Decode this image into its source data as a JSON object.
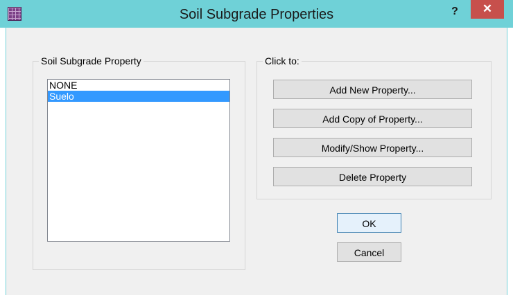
{
  "window": {
    "title": "Soil Subgrade Properties",
    "help_glyph": "?",
    "close_glyph": "✕"
  },
  "property_group": {
    "label": "Soil Subgrade Property",
    "items": [
      {
        "label": "NONE",
        "selected": false
      },
      {
        "label": "Suelo",
        "selected": true
      }
    ]
  },
  "actions_group": {
    "label": "Click to:",
    "buttons": [
      {
        "label": "Add New Property..."
      },
      {
        "label": "Add Copy of Property..."
      },
      {
        "label": "Modify/Show Property..."
      },
      {
        "label": "Delete Property"
      }
    ]
  },
  "dialog_buttons": {
    "ok": "OK",
    "cancel": "Cancel"
  },
  "colors": {
    "titlebar": "#6fd1d7",
    "close_button": "#c7504c",
    "selection": "#3399ff"
  }
}
